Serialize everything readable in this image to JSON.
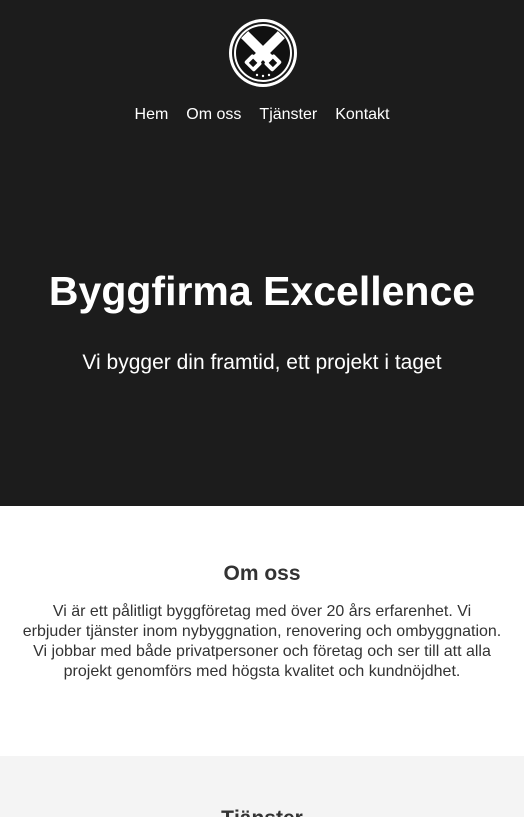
{
  "nav": {
    "items": [
      "Hem",
      "Om oss",
      "Tjänster",
      "Kontakt"
    ]
  },
  "hero": {
    "title": "Byggfirma Excellence",
    "subtitle": "Vi bygger din framtid, ett projekt i taget"
  },
  "about": {
    "heading": "Om oss",
    "text": "Vi är ett pålitligt byggföretag med över 20 års erfarenhet. Vi erbjuder tjänster inom nybyggnation, renovering och ombyggnation. Vi jobbar med både privatpersoner och företag och ser till att alla projekt genomförs med högsta kvalitet och kundnöjdhet."
  },
  "services": {
    "heading": "Tjänster"
  },
  "colors": {
    "hero_bg": "#1c1c1c",
    "services_bg": "#f4f4f4"
  }
}
